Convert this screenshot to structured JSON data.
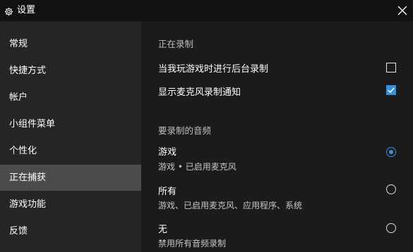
{
  "window": {
    "title": "设置",
    "icon": "gear-icon",
    "close_icon": "close-icon"
  },
  "sidebar": {
    "items": [
      {
        "label": "常规",
        "active": false
      },
      {
        "label": "快捷方式",
        "active": false
      },
      {
        "label": "帐户",
        "active": false
      },
      {
        "label": "小组件菜单",
        "active": false
      },
      {
        "label": "个性化",
        "active": false
      },
      {
        "label": "正在捕获",
        "active": true
      },
      {
        "label": "游戏功能",
        "active": false
      },
      {
        "label": "反馈",
        "active": false
      }
    ]
  },
  "recording": {
    "heading": "正在录制",
    "background_recording": {
      "label": "当我玩游戏时进行后台录制",
      "checked": false
    },
    "mic_notification": {
      "label": "显示麦克风录制通知",
      "checked": true
    }
  },
  "audio": {
    "heading": "要录制的音频",
    "options": [
      {
        "title": "游戏",
        "description": "游戏 • 已启用麦克风",
        "selected": true
      },
      {
        "title": "所有",
        "description": "游戏、已启用麦克风、应用程序、系统",
        "selected": false
      },
      {
        "title": "无",
        "description": "禁用所有音频录制",
        "selected": false
      }
    ]
  },
  "colors": {
    "accent": "#3a8fd9",
    "titlebar": "#111111",
    "sidebar": "#252525",
    "sidebar_active": "#4b4b4b",
    "content": "#1b1b1b"
  }
}
